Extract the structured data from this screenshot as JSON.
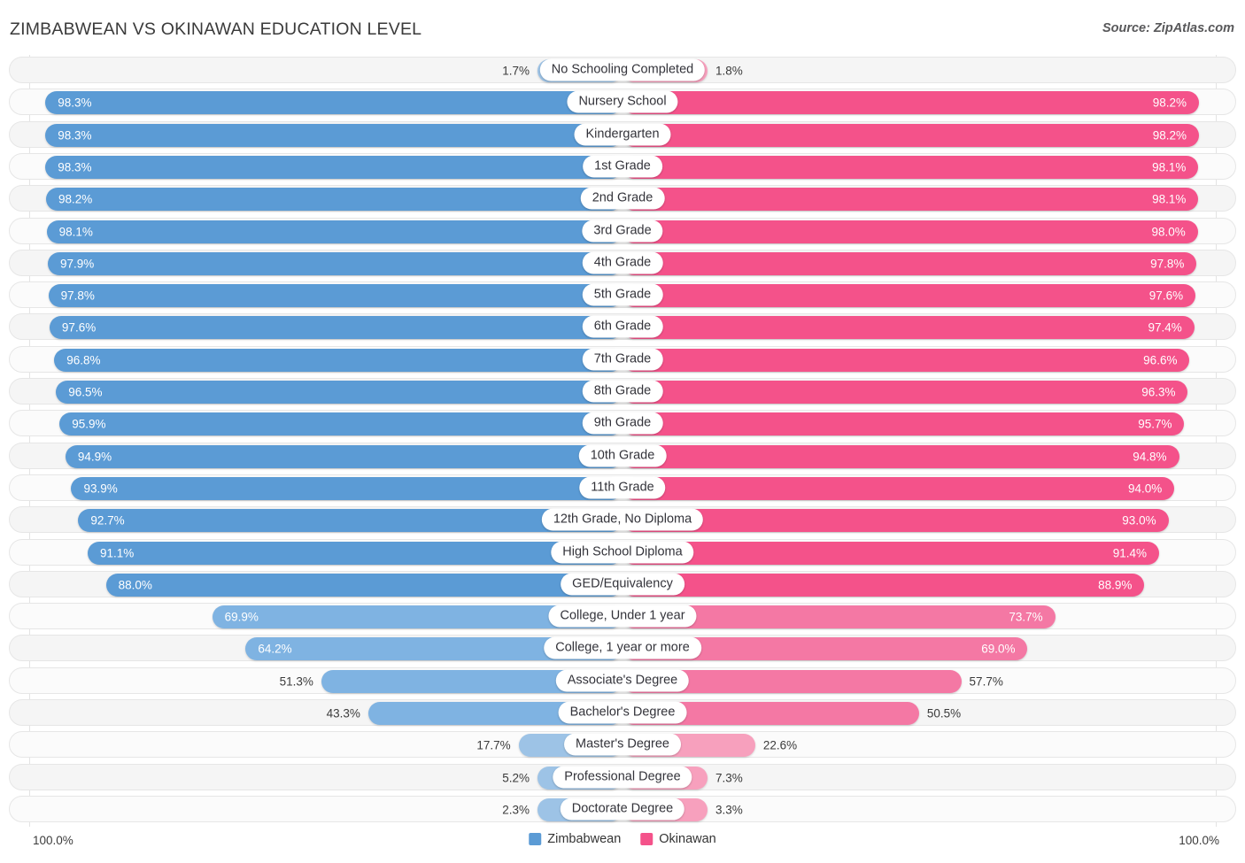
{
  "header": {
    "title": "ZIMBABWEAN VS OKINAWAN EDUCATION LEVEL",
    "source": "Source: ZipAtlas.com"
  },
  "footer": {
    "axis_min": "100.0%",
    "axis_max": "100.0%"
  },
  "legend": {
    "items": [
      {
        "label": "Zimbabwean",
        "color": "#5b9bd5"
      },
      {
        "label": "Okinawan",
        "color": "#f4528a"
      }
    ]
  },
  "colors": {
    "blue_dark": "#5b9bd5",
    "blue_mid": "#7fb3e2",
    "blue_light": "#9dc3e6",
    "pink_dark": "#f4528a",
    "pink_mid": "#f478a4",
    "pink_light": "#f7a0bd",
    "row_bg": "#f5f5f5",
    "gridline": "#e3e3e3"
  },
  "chart_data": {
    "type": "bar",
    "title": "ZIMBABWEAN VS OKINAWAN EDUCATION LEVEL",
    "orientation": "horizontal-diverging",
    "xlabel": "",
    "ylabel": "",
    "xlim": [
      0,
      100
    ],
    "grid": true,
    "legend_position": "bottom-center",
    "categories": [
      "No Schooling Completed",
      "Nursery School",
      "Kindergarten",
      "1st Grade",
      "2nd Grade",
      "3rd Grade",
      "4th Grade",
      "5th Grade",
      "6th Grade",
      "7th Grade",
      "8th Grade",
      "9th Grade",
      "10th Grade",
      "11th Grade",
      "12th Grade, No Diploma",
      "High School Diploma",
      "GED/Equivalency",
      "College, Under 1 year",
      "College, 1 year or more",
      "Associate's Degree",
      "Bachelor's Degree",
      "Master's Degree",
      "Professional Degree",
      "Doctorate Degree"
    ],
    "series": [
      {
        "name": "Zimbabwean",
        "color": "#5b9bd5",
        "values": [
          1.7,
          98.3,
          98.3,
          98.3,
          98.2,
          98.1,
          97.9,
          97.8,
          97.6,
          96.8,
          96.5,
          95.9,
          94.9,
          93.9,
          92.7,
          91.1,
          88.0,
          69.9,
          64.2,
          51.3,
          43.3,
          17.7,
          5.2,
          2.3
        ],
        "labels": [
          "1.7%",
          "98.3%",
          "98.3%",
          "98.3%",
          "98.2%",
          "98.1%",
          "97.9%",
          "97.8%",
          "97.6%",
          "96.8%",
          "96.5%",
          "95.9%",
          "94.9%",
          "93.9%",
          "92.7%",
          "91.1%",
          "88.0%",
          "69.9%",
          "64.2%",
          "51.3%",
          "43.3%",
          "17.7%",
          "5.2%",
          "2.3%"
        ]
      },
      {
        "name": "Okinawan",
        "color": "#f4528a",
        "values": [
          1.8,
          98.2,
          98.2,
          98.1,
          98.1,
          98.0,
          97.8,
          97.6,
          97.4,
          96.6,
          96.3,
          95.7,
          94.8,
          94.0,
          93.0,
          91.4,
          88.9,
          73.7,
          69.0,
          57.7,
          50.5,
          22.6,
          7.3,
          3.3
        ],
        "labels": [
          "1.8%",
          "98.2%",
          "98.2%",
          "98.1%",
          "98.1%",
          "98.0%",
          "97.8%",
          "97.6%",
          "97.4%",
          "96.6%",
          "96.3%",
          "95.7%",
          "94.8%",
          "94.0%",
          "93.0%",
          "91.4%",
          "88.9%",
          "73.7%",
          "69.0%",
          "57.7%",
          "50.5%",
          "22.6%",
          "7.3%",
          "3.3%"
        ]
      }
    ]
  }
}
